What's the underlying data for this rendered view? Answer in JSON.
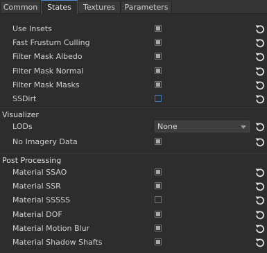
{
  "tabs": [
    {
      "label": "Common"
    },
    {
      "label": "States"
    },
    {
      "label": "Textures"
    },
    {
      "label": "Parameters"
    }
  ],
  "states": [
    {
      "label": "Use Insets",
      "checked": true
    },
    {
      "label": "Fast Frustum Culling",
      "checked": true
    },
    {
      "label": "Filter Mask Albedo",
      "checked": true
    },
    {
      "label": "Filter Mask Normal",
      "checked": true
    },
    {
      "label": "Filter Mask Masks",
      "checked": true
    },
    {
      "label": "SSDirt",
      "checked": false
    }
  ],
  "visualizer": {
    "title": "Visualizer",
    "lods_label": "LODs",
    "lods_value": "None",
    "no_imagery_label": "No Imagery Data",
    "no_imagery_checked": true
  },
  "post_processing": {
    "title": "Post Processing",
    "items": [
      {
        "label": "Material SSAO",
        "checked": true
      },
      {
        "label": "Material SSR",
        "checked": true
      },
      {
        "label": "Material SSSSS",
        "checked": false
      },
      {
        "label": "Material DOF",
        "checked": true
      },
      {
        "label": "Material Motion Blur",
        "checked": true
      },
      {
        "label": "Material Shadow Shafts",
        "checked": true
      }
    ]
  },
  "icons": {
    "reset": "reset-icon",
    "dropdown_arrow": "chevron-down-icon"
  },
  "colors": {
    "background": "#2d2d2d",
    "active_tab_accent": "#4b8fd8",
    "check_fill": "#a9a9a9"
  }
}
